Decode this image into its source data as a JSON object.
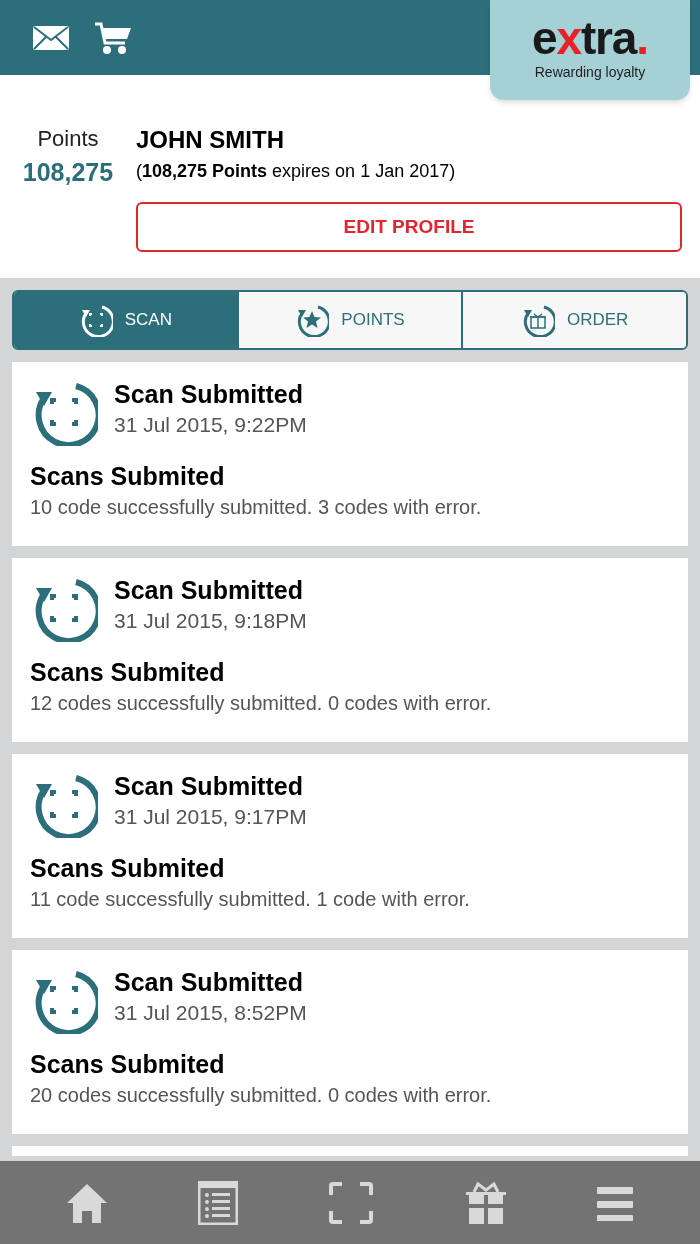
{
  "logo": {
    "parts": [
      {
        "text": "e",
        "kind": "plain"
      },
      {
        "text": "x",
        "kind": "accent"
      },
      {
        "text": "tra",
        "kind": "plain"
      },
      {
        "text": ".",
        "kind": "accent"
      }
    ],
    "tagline": "Rewarding loyalty"
  },
  "profile": {
    "points_label": "Points",
    "points_value": "108,275",
    "name": "JOHN SMITH",
    "expiry": "(**108,275 Points** expires on 1 Jan 2017)",
    "edit_button": "EDIT PROFILE"
  },
  "tabs": [
    {
      "label": "SCAN",
      "kind": "scan",
      "selected": true
    },
    {
      "label": "POINTS",
      "kind": "points",
      "selected": false
    },
    {
      "label": "ORDER",
      "kind": "order",
      "selected": false
    }
  ],
  "entries": [
    {
      "title": "Scan Submitted",
      "date": "31 Jul 2015, 9:22PM",
      "heading": "Scans Submited",
      "detail": "10 code successfully submitted. 3 codes with error."
    },
    {
      "title": "Scan Submitted",
      "date": "31 Jul 2015, 9:18PM",
      "heading": "Scans Submited",
      "detail": "12 codes successfully submitted. 0 codes with error."
    },
    {
      "title": "Scan Submitted",
      "date": "31 Jul 2015, 9:17PM",
      "heading": "Scans Submited",
      "detail": "11 code successfully submitted. 1 code with error."
    },
    {
      "title": "Scan Submitted",
      "date": "31 Jul 2015, 8:52PM",
      "heading": "Scans Submited",
      "detail": "20 codes successfully submitted. 0 codes with error."
    }
  ],
  "bottom_nav": [
    {
      "kind": "home"
    },
    {
      "kind": "list"
    },
    {
      "kind": "scan"
    },
    {
      "kind": "gift"
    },
    {
      "kind": "menu"
    }
  ]
}
